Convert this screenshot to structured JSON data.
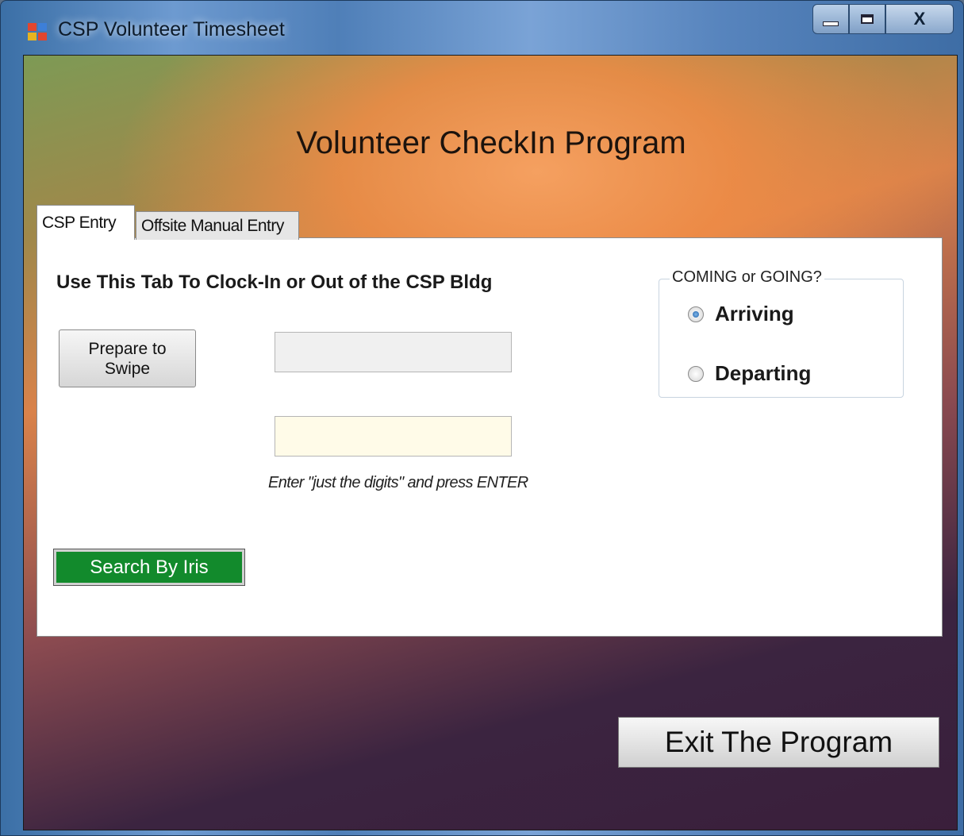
{
  "window": {
    "title": "CSP Volunteer Timesheet",
    "controls": {
      "minimize": "minimize",
      "maximize": "maximize",
      "close": "X"
    }
  },
  "app": {
    "heading": "Volunteer CheckIn Program"
  },
  "tabs": [
    {
      "label": "CSP Entry",
      "active": true
    },
    {
      "label": "Offsite Manual Entry",
      "active": false
    }
  ],
  "csp_entry": {
    "instruction": "Use This Tab To Clock-In or Out of the CSP Bldg",
    "prepare_button": {
      "line1": "Prepare to",
      "line2": "Swipe"
    },
    "swipe_field": {
      "value": ""
    },
    "digits_field": {
      "value": ""
    },
    "hint": "Enter \"just the digits\" and press ENTER",
    "iris_button": "Search By Iris",
    "direction_group": {
      "legend": "COMING or  GOING?",
      "options": [
        {
          "label": "Arriving",
          "selected": true
        },
        {
          "label": "Departing",
          "selected": false
        }
      ]
    }
  },
  "exit_button": "Exit The Program",
  "colors": {
    "iris_button_bg": "#128a2c",
    "digits_field_bg": "#fffbe8"
  }
}
